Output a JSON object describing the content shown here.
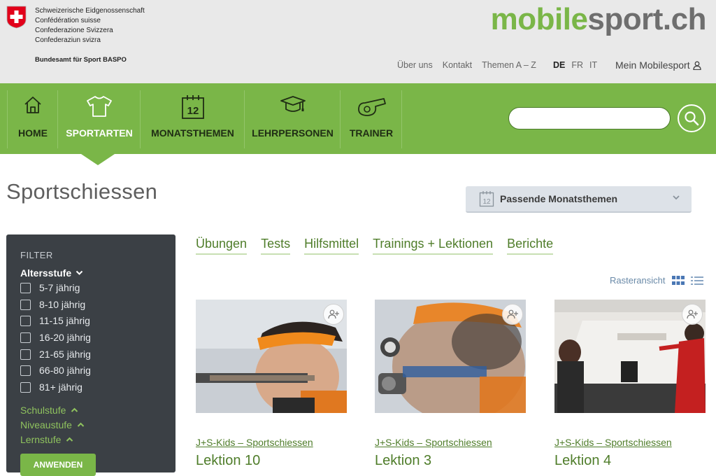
{
  "header": {
    "confederation": [
      "Schweizerische Eidgenossenschaft",
      "Confédération suisse",
      "Confederazione Svizzera",
      "Confederaziun svizra"
    ],
    "office": "Bundesamt für Sport BASPO",
    "brand_part1": "mobile",
    "brand_part2": "sport.ch",
    "meta_links": [
      "Über uns",
      "Kontakt",
      "Themen A – Z"
    ],
    "languages": [
      "DE",
      "FR",
      "IT"
    ],
    "active_language": "DE",
    "account_label": "Mein Mobilesport",
    "account_icon": "user-icon"
  },
  "nav": {
    "items": [
      {
        "label": "HOME",
        "icon": "home-icon"
      },
      {
        "label": "SPORTARTEN",
        "icon": "tshirt-icon"
      },
      {
        "label": "MONATSTHEMEN",
        "icon": "calendar-icon"
      },
      {
        "label": "LEHRPERSONEN",
        "icon": "mortarboard-icon"
      },
      {
        "label": "TRAINER",
        "icon": "whistle-icon"
      }
    ],
    "active": "SPORTARTEN",
    "calendar_number": "12",
    "search_placeholder": "",
    "search_icon": "search-icon"
  },
  "page": {
    "title": "Sportschiessen",
    "month_dropdown": {
      "label": "Passende Monatsthemen",
      "icon_number": "12"
    }
  },
  "filter": {
    "title": "FILTER",
    "group_label": "Altersstufe",
    "age_options": [
      "5-7 jährig",
      "8-10 jährig",
      "11-15 jährig",
      "16-20 jährig",
      "21-65 jährig",
      "66-80 jährig",
      "81+ jährig"
    ],
    "sections": [
      "Schulstufe",
      "Niveaustufe",
      "Lernstufe"
    ],
    "apply_label": "ANWENDEN"
  },
  "tabs": [
    "Übungen",
    "Tests",
    "Hilfsmittel",
    "Trainings + Lektionen",
    "Berichte"
  ],
  "view": {
    "label": "Rasteransicht",
    "modes": [
      "grid-icon",
      "list-icon"
    ],
    "active": "grid"
  },
  "cards": [
    {
      "category": "J+S-Kids – Sportschiessen",
      "title": "Lektion 10"
    },
    {
      "category": "J+S-Kids – Sportschiessen",
      "title": "Lektion 3"
    },
    {
      "category": "J+S-Kids – Sportschiessen",
      "title": "Lektion 4"
    }
  ],
  "colors": {
    "green": "#7ab648",
    "dark_green": "#4f7d2a",
    "filter_bg": "#3b4045",
    "topbar_bg": "#e9e9e9"
  }
}
